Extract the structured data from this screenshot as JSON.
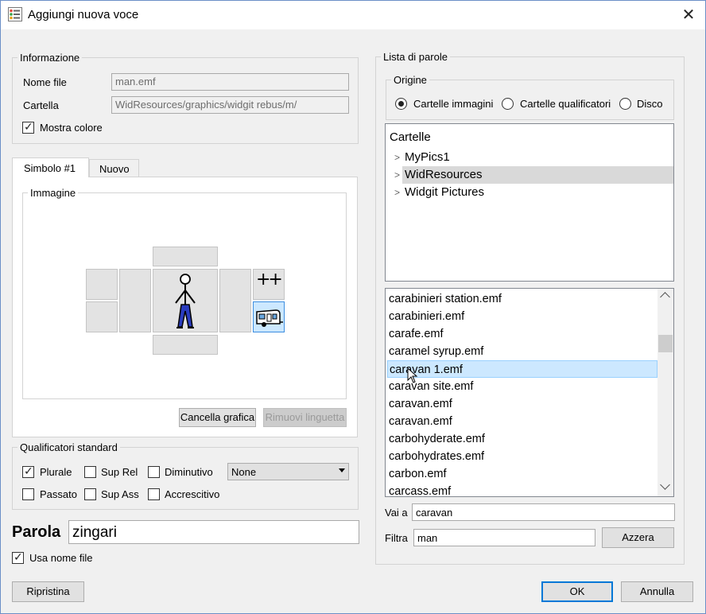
{
  "window": {
    "title": "Aggiungi nuova voce",
    "close_glyph": "✕"
  },
  "info": {
    "legend": "Informazione",
    "filename_label": "Nome file",
    "filename_value": "man.emf",
    "folder_label": "Cartella",
    "folder_value": "WidResources/graphics/widgit rebus/m/",
    "show_color_label": "Mostra colore"
  },
  "tabs": [
    {
      "label": "Simbolo #1"
    },
    {
      "label": "Nuovo"
    }
  ],
  "image": {
    "legend": "Immagine",
    "plus_symbol": "++",
    "clear_button": "Cancella grafica",
    "remove_tab_button": "Rimuovi linguetta"
  },
  "qualifiers": {
    "legend": "Qualificatori standard",
    "plural": "Plurale",
    "sup_rel": "Sup Rel",
    "diminutive": "Diminutivo",
    "past": "Passato",
    "sup_ass": "Sup Ass",
    "augmentative": "Accrescitivo",
    "select_value": "None"
  },
  "word": {
    "label": "Parola",
    "value": "zingari",
    "use_filename_label": "Usa nome file"
  },
  "wordlist": {
    "legend": "Lista di parole",
    "origin": {
      "legend": "Origine",
      "options": [
        "Cartelle immagini",
        "Cartelle qualificatori",
        "Disco"
      ]
    },
    "tree": {
      "header": "Cartelle",
      "items": [
        "MyPics1",
        "WidResources",
        "Widgit Pictures"
      ]
    },
    "files": [
      "carabinieri station.emf",
      "carabinieri.emf",
      "carafe.emf",
      "caramel syrup.emf",
      "caravan 1.emf",
      "caravan site.emf",
      "caravan.emf",
      "caravan.emf",
      "carbohyderate.emf",
      "carbohydrates.emf",
      "carbon.emf",
      "carcass.emf"
    ],
    "goto_label": "Vai a",
    "goto_value": "caravan",
    "filter_label": "Filtra",
    "filter_value": "man",
    "reset_button": "Azzera"
  },
  "footer": {
    "restore_button": "Ripristina",
    "ok_button": "OK",
    "cancel_button": "Annulla"
  }
}
